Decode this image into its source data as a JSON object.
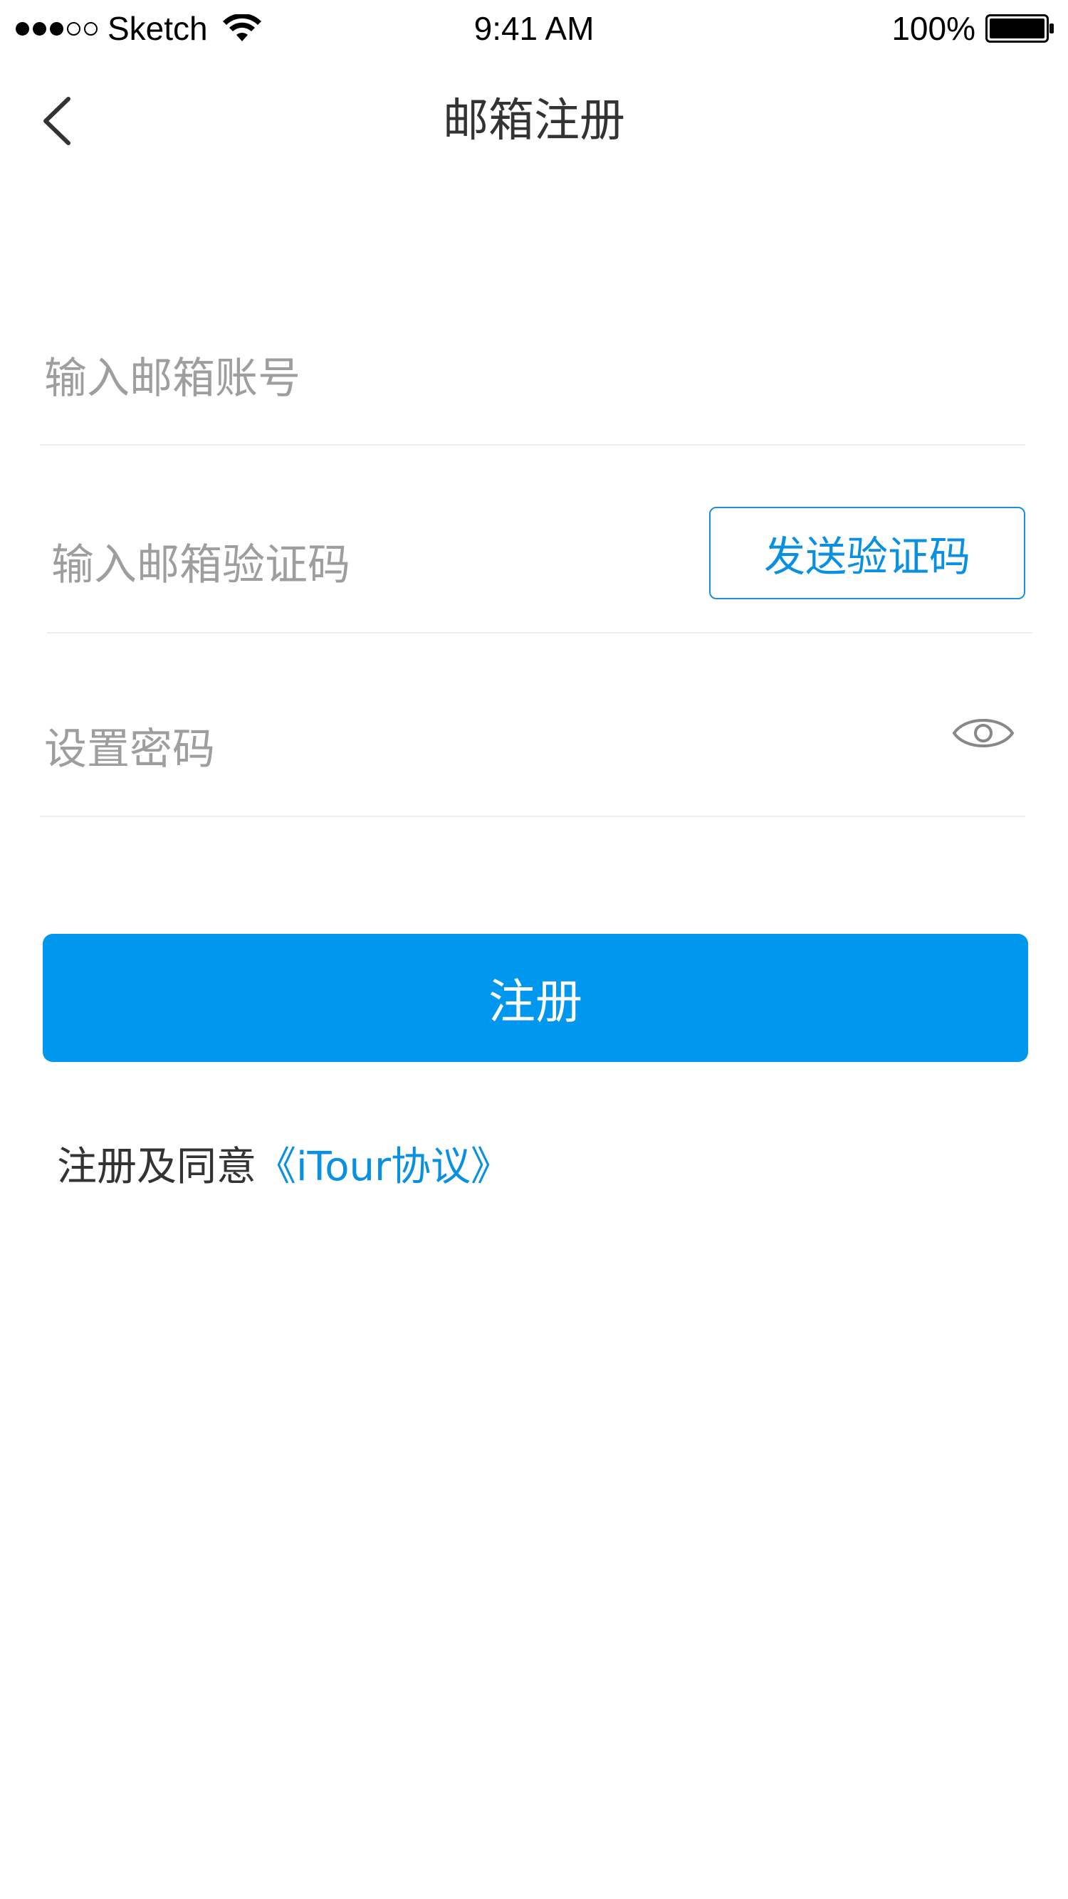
{
  "status_bar": {
    "carrier": "Sketch",
    "time": "9:41 AM",
    "battery_percent": "100%",
    "signal_bars_filled": 3,
    "signal_bars_total": 5
  },
  "nav": {
    "title": "邮箱注册",
    "back_icon": "chevron-left-icon"
  },
  "form": {
    "email_placeholder": "输入邮箱账号",
    "code_placeholder": "输入邮箱验证码",
    "send_code_label": "发送验证码",
    "password_placeholder": "设置密码",
    "password_toggle_icon": "eye-icon"
  },
  "submit": {
    "label": "注册"
  },
  "agreement": {
    "prefix": "注册及同意",
    "link": "《iTour协议》"
  },
  "colors": {
    "accent": "#0097ee",
    "link": "#0a90e0",
    "placeholder": "#9e9e9e",
    "divider": "#eeeeee"
  }
}
